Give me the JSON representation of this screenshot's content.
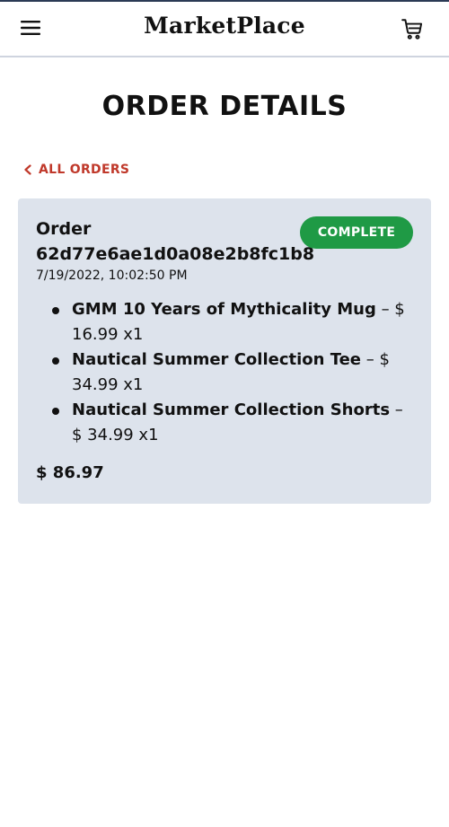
{
  "header": {
    "brand": "MarketPlace",
    "menu_icon": "hamburger-menu-icon",
    "cart_icon": "shopping-cart-icon"
  },
  "page": {
    "title": "ORDER DETAILS",
    "back_link": "ALL ORDERS",
    "back_icon": "chevron-left-icon"
  },
  "order": {
    "label": "Order",
    "id": "62d77e6ae1d0a08e2b8fc1b8",
    "date": "7/19/2022, 10:02:50 PM",
    "status": "COMPLETE",
    "items": [
      {
        "name": "GMM 10 Years of Mythicality Mug",
        "detail": " – $ 16.99 x1"
      },
      {
        "name": "Nautical Summer Collection Tee",
        "detail": " – $ 34.99 x1"
      },
      {
        "name": "Nautical Summer Collection Shorts",
        "detail": " – $ 34.99 x1"
      }
    ],
    "total": "$ 86.97"
  },
  "colors": {
    "accent_link": "#c0392b",
    "status_complete": "#1f9a45",
    "card_background": "#dde3ec",
    "header_top_border": "#2b3a55"
  }
}
